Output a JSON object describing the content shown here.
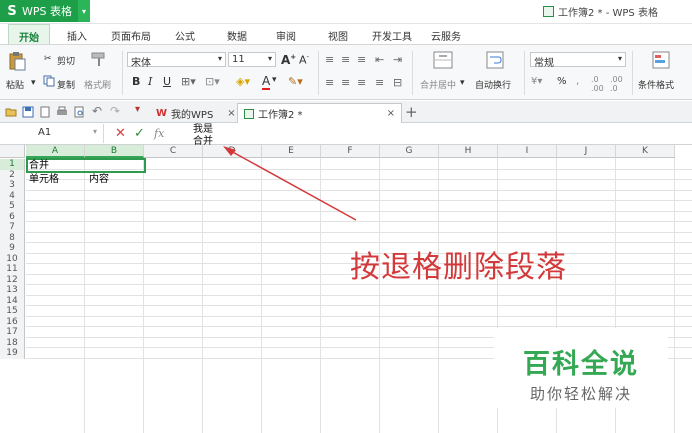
{
  "app": {
    "badge_logo": "S",
    "badge_title": "WPS 表格",
    "window_title": "工作簿2 * - WPS 表格"
  },
  "menu": [
    "开始",
    "插入",
    "页面布局",
    "公式",
    "数据",
    "审阅",
    "视图",
    "开发工具",
    "云服务"
  ],
  "ribbon": {
    "paste": "粘贴",
    "cut": "剪切",
    "copy": "复制",
    "format_painter": "格式刷",
    "font_name": "宋体",
    "font_size": "11",
    "bold": "B",
    "italic": "I",
    "underline": "U",
    "merge_center": "合并居中",
    "wrap_text": "自动换行",
    "number_format": "常规",
    "percent": "%",
    "conditional_format": "条件格式"
  },
  "tabs": [
    {
      "label": "我的WPS"
    },
    {
      "label": "工作簿2 *"
    }
  ],
  "formula_bar": {
    "name_box": "A1",
    "fx": "fx",
    "content_line1": "我是",
    "content_line2": "合并"
  },
  "columns": [
    "A",
    "B",
    "C",
    "D",
    "E",
    "F",
    "G",
    "H",
    "I",
    "J",
    "K"
  ],
  "rows": [
    "1",
    "2",
    "3",
    "4",
    "5",
    "6",
    "7",
    "8",
    "9",
    "10",
    "11",
    "12",
    "13",
    "14",
    "15",
    "16",
    "17",
    "18",
    "19"
  ],
  "cells": {
    "A1": "合并",
    "A2": "单元格",
    "B2": "内容"
  },
  "annotation": "按退格删除段落",
  "watermark": {
    "main": "百科全说",
    "sub": "助你轻松解决"
  },
  "colors": {
    "brand_green": "#1f9e49",
    "annotation_red": "#d3393a"
  }
}
